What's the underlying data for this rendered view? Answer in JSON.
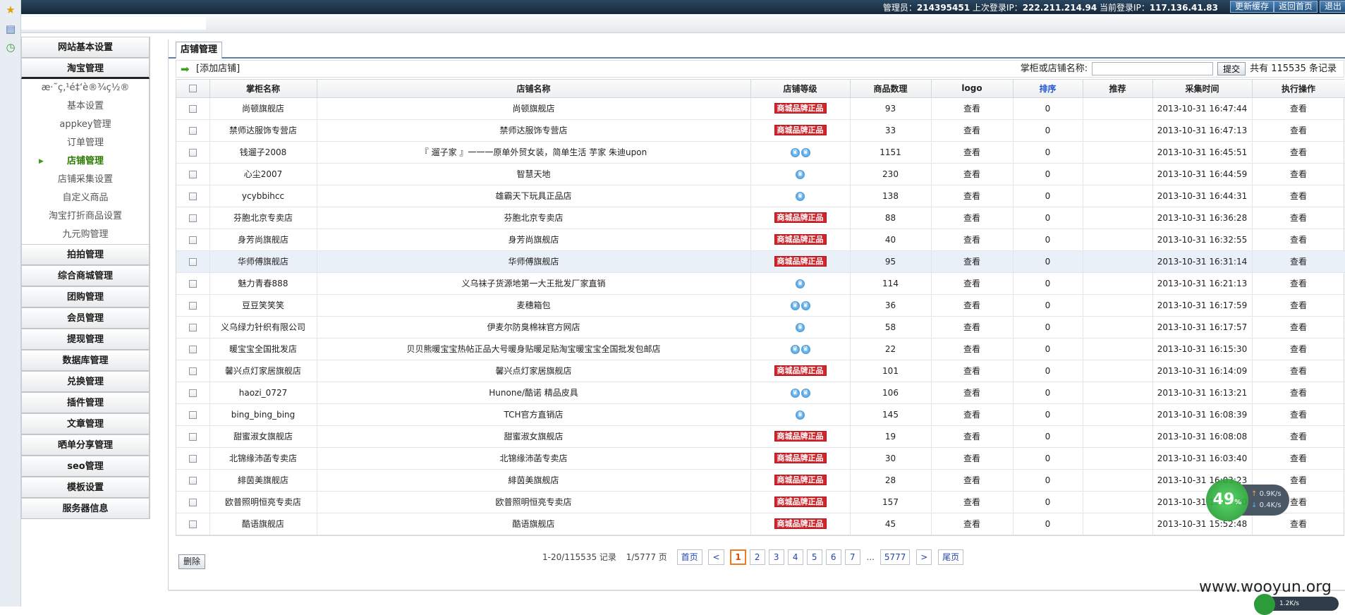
{
  "topbar": {
    "admin_label": "管理员：",
    "admin_value": "214395451",
    "last_ip_label": "上次登录IP：",
    "last_ip_value": "222.211.214.94",
    "cur_ip_label": "当前登录IP：",
    "cur_ip_value": "117.136.41.83",
    "btn_cache": "更新缓存",
    "btn_home": "返回首页",
    "btn_logout": "退出"
  },
  "left_strip": {
    "icons": [
      "star-icon",
      "book-icon",
      "clock-icon"
    ]
  },
  "sidebar": {
    "sections_top": [
      "网站基本设置",
      "淘宝管理"
    ],
    "subitems": [
      "æ·˜ç‚¹é‡‘è®¾ç½®",
      "基本设置",
      "appkey管理",
      "订单管理",
      "店铺管理",
      "店铺采集设置",
      "自定义商品",
      "淘宝打折商品设置",
      "九元购管理"
    ],
    "active_subitem": "店铺管理",
    "sections_bottom": [
      "拍拍管理",
      "综合商城管理",
      "团购管理",
      "会员管理",
      "提现管理",
      "数据库管理",
      "兑换管理",
      "插件管理",
      "文章管理",
      "晒单分享管理",
      "seo管理",
      "模板设置",
      "服务器信息"
    ]
  },
  "main": {
    "tab_label": "店铺管理",
    "add_label": "[添加店铺]",
    "search_label": "掌柜或店铺名称:",
    "search_value": "",
    "submit_label": "提交",
    "total_label": "共有 115535 条记录"
  },
  "table": {
    "columns": [
      "掌柜名称",
      "店铺名称",
      "店铺等级",
      "商品数理",
      "logo",
      "排序",
      "推荐",
      "采集时间",
      "执行操作"
    ],
    "rows": [
      {
        "owner": "尚顿旗舰店",
        "shop": "尚顿旗舰店",
        "level": "tmall",
        "count": "93",
        "logo": "查看",
        "sort": "0",
        "rec": "",
        "time": "2013-10-31 16:47:44",
        "op": "查看"
      },
      {
        "owner": "禁师达服饰专营店",
        "shop": "禁师达服饰专营店",
        "level": "tmall",
        "count": "33",
        "logo": "查看",
        "sort": "0",
        "rec": "",
        "time": "2013-10-31 16:47:13",
        "op": "查看"
      },
      {
        "owner": "钱遛子2008",
        "shop": "『 遛子家 』一一一原单外贸女装，简单生活 芋家 朱迪upon",
        "level": "crown2",
        "count": "1151",
        "logo": "查看",
        "sort": "0",
        "rec": "",
        "time": "2013-10-31 16:45:51",
        "op": "查看"
      },
      {
        "owner": "心尘2007",
        "shop": "智慧天地",
        "level": "crown1",
        "count": "230",
        "logo": "查看",
        "sort": "0",
        "rec": "",
        "time": "2013-10-31 16:44:59",
        "op": "查看"
      },
      {
        "owner": "ycybbihcc",
        "shop": "雄霸天下玩具正品店",
        "level": "crown1",
        "count": "138",
        "logo": "查看",
        "sort": "0",
        "rec": "",
        "time": "2013-10-31 16:44:31",
        "op": "查看"
      },
      {
        "owner": "芬胞北京专卖店",
        "shop": "芬胞北京专卖店",
        "level": "tmall",
        "count": "88",
        "logo": "查看",
        "sort": "0",
        "rec": "",
        "time": "2013-10-31 16:36:28",
        "op": "查看"
      },
      {
        "owner": "身芳尚旗舰店",
        "shop": "身芳尚旗舰店",
        "level": "tmall",
        "count": "40",
        "logo": "查看",
        "sort": "0",
        "rec": "",
        "time": "2013-10-31 16:32:55",
        "op": "查看"
      },
      {
        "owner": "华师傅旗舰店",
        "shop": "华师傅旗舰店",
        "level": "tmall",
        "count": "95",
        "logo": "查看",
        "sort": "0",
        "rec": "",
        "time": "2013-10-31 16:31:14",
        "op": "查看"
      },
      {
        "owner": "魅力青春888",
        "shop": "义乌袜子货源地第一大王批发厂家直销",
        "level": "crown1",
        "count": "114",
        "logo": "查看",
        "sort": "0",
        "rec": "",
        "time": "2013-10-31 16:21:13",
        "op": "查看"
      },
      {
        "owner": "豆豆笑笑笑",
        "shop": "麦穗箱包",
        "level": "crown2",
        "count": "36",
        "logo": "查看",
        "sort": "0",
        "rec": "",
        "time": "2013-10-31 16:17:59",
        "op": "查看"
      },
      {
        "owner": "义乌绿力针织有限公司",
        "shop": "伊麦尔防臭棉袜官方网店",
        "level": "crown1",
        "count": "58",
        "logo": "查看",
        "sort": "0",
        "rec": "",
        "time": "2013-10-31 16:17:57",
        "op": "查看"
      },
      {
        "owner": "暖宝宝全国批发店",
        "shop": "贝贝熊暖宝宝热帖正品大号暖身贴暖足贴淘宝暖宝宝全国批发包邮店",
        "level": "crown2",
        "count": "22",
        "logo": "查看",
        "sort": "0",
        "rec": "",
        "time": "2013-10-31 16:15:30",
        "op": "查看"
      },
      {
        "owner": "馨兴点灯家居旗舰店",
        "shop": "馨兴点灯家居旗舰店",
        "level": "tmall",
        "count": "101",
        "logo": "查看",
        "sort": "0",
        "rec": "",
        "time": "2013-10-31 16:14:09",
        "op": "查看"
      },
      {
        "owner": "haozi_0727",
        "shop": "Hunone/酷诺 精品皮具",
        "level": "crown2",
        "count": "106",
        "logo": "查看",
        "sort": "0",
        "rec": "",
        "time": "2013-10-31 16:13:21",
        "op": "查看"
      },
      {
        "owner": "bing_bing_bing",
        "shop": "TCH官方直销店",
        "level": "crown1",
        "count": "145",
        "logo": "查看",
        "sort": "0",
        "rec": "",
        "time": "2013-10-31 16:08:39",
        "op": "查看"
      },
      {
        "owner": "甜蜜淑女旗舰店",
        "shop": "甜蜜淑女旗舰店",
        "level": "tmall",
        "count": "19",
        "logo": "查看",
        "sort": "0",
        "rec": "",
        "time": "2013-10-31 16:08:08",
        "op": "查看"
      },
      {
        "owner": "北锦缘沛菡专卖店",
        "shop": "北锦缘沛菡专卖店",
        "level": "tmall",
        "count": "30",
        "logo": "查看",
        "sort": "0",
        "rec": "",
        "time": "2013-10-31 16:03:40",
        "op": "查看"
      },
      {
        "owner": "緋茵美旗舰店",
        "shop": "緋茵美旗舰店",
        "level": "tmall",
        "count": "28",
        "logo": "查看",
        "sort": "0",
        "rec": "",
        "time": "2013-10-31 16:03:23",
        "op": "查看"
      },
      {
        "owner": "欧普照明恒亮专卖店",
        "shop": "欧普照明恒亮专卖店",
        "level": "tmall",
        "count": "157",
        "logo": "查看",
        "sort": "0",
        "rec": "",
        "time": "2013-10-31 16:02:30",
        "op": "查看"
      },
      {
        "owner": "酷语旗舰店",
        "shop": "酷语旗舰店",
        "level": "tmall",
        "count": "45",
        "logo": "查看",
        "sort": "0",
        "rec": "",
        "time": "2013-10-31 15:52:48",
        "op": "查看"
      }
    ],
    "highlight_row": 7,
    "tmall_badge": "商城品牌正品"
  },
  "footer": {
    "delete_label": "删除",
    "records_text": "1-20/115535 记录",
    "pages_text": "1/5777 页",
    "first_label": "首页",
    "prev_label": "<",
    "pages": [
      "1",
      "2",
      "3",
      "4",
      "5",
      "6",
      "7"
    ],
    "current_page": "1",
    "ellipsis": "...",
    "last_page": "5777",
    "next_label": ">",
    "last_label": "尾页"
  },
  "overlay": {
    "net_percent": "49",
    "net_percent_unit": "%",
    "up_speed": "0.9K/s",
    "down_speed": "0.4K/s",
    "watermark": "www.wooyun.org",
    "net2_speed": "1.2K/s"
  },
  "colors": {
    "accent": "#2457d6",
    "tmall_red": "#d2262d",
    "active_green": "#2a7a00",
    "pager_current": "#f07a22"
  }
}
